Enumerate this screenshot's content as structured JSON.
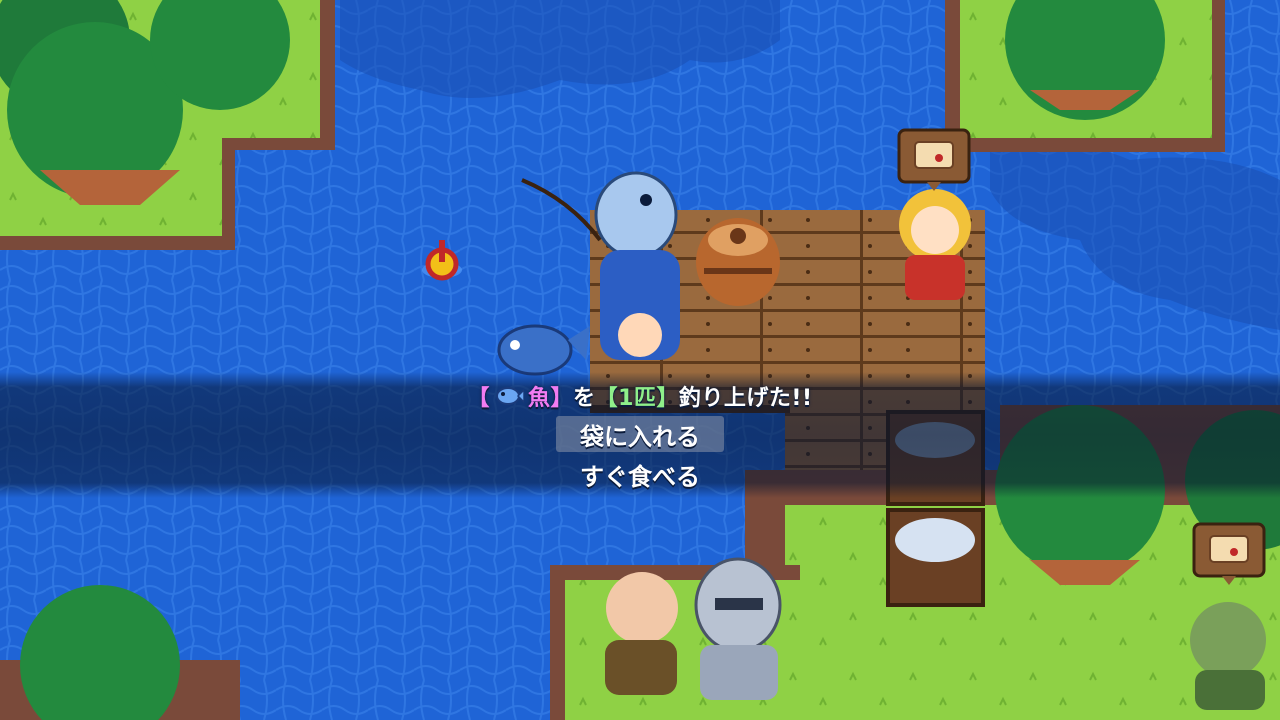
{
  "message": {
    "bracket_open_1": "【",
    "item_icon": "fish-icon",
    "item_name": "魚",
    "bracket_close_1": "】",
    "particle": "を",
    "bracket_open_2": "【",
    "quantity": "1匹",
    "bracket_close_2": "】",
    "verb": "釣り上げた!!"
  },
  "choices": [
    {
      "label": "袋に入れる",
      "selected": true
    },
    {
      "label": "すぐ食べる",
      "selected": false
    }
  ],
  "colors": {
    "item_name": "#f17cf2",
    "quantity": "#8ff08a",
    "water": "#1f64d6",
    "grass": "#8fd145"
  },
  "map_icons": [
    "scroll-icon",
    "scroll-icon"
  ]
}
